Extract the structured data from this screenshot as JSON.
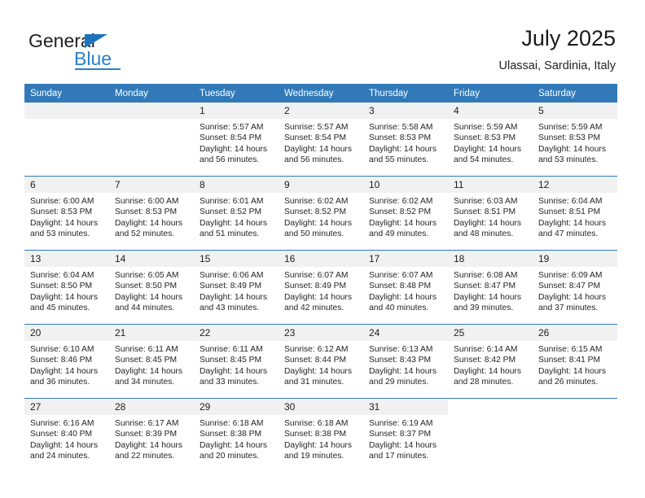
{
  "brand": {
    "name_part1": "General",
    "name_part2": "Blue"
  },
  "header": {
    "title": "July 2025",
    "subtitle": "Ulassai, Sardinia, Italy"
  },
  "calendar": {
    "weekday_headers": [
      "Sunday",
      "Monday",
      "Tuesday",
      "Wednesday",
      "Thursday",
      "Friday",
      "Saturday"
    ],
    "accent_color": "#3179b8",
    "daynum_band_color": "#f1f1f1",
    "weeks": [
      [
        {
          "day": "",
          "sunrise": "",
          "sunset": "",
          "daylight": "",
          "empty": true
        },
        {
          "day": "",
          "sunrise": "",
          "sunset": "",
          "daylight": "",
          "empty": true
        },
        {
          "day": "1",
          "sunrise": "Sunrise: 5:57 AM",
          "sunset": "Sunset: 8:54 PM",
          "daylight": "Daylight: 14 hours and 56 minutes."
        },
        {
          "day": "2",
          "sunrise": "Sunrise: 5:57 AM",
          "sunset": "Sunset: 8:54 PM",
          "daylight": "Daylight: 14 hours and 56 minutes."
        },
        {
          "day": "3",
          "sunrise": "Sunrise: 5:58 AM",
          "sunset": "Sunset: 8:53 PM",
          "daylight": "Daylight: 14 hours and 55 minutes."
        },
        {
          "day": "4",
          "sunrise": "Sunrise: 5:59 AM",
          "sunset": "Sunset: 8:53 PM",
          "daylight": "Daylight: 14 hours and 54 minutes."
        },
        {
          "day": "5",
          "sunrise": "Sunrise: 5:59 AM",
          "sunset": "Sunset: 8:53 PM",
          "daylight": "Daylight: 14 hours and 53 minutes."
        }
      ],
      [
        {
          "day": "6",
          "sunrise": "Sunrise: 6:00 AM",
          "sunset": "Sunset: 8:53 PM",
          "daylight": "Daylight: 14 hours and 53 minutes."
        },
        {
          "day": "7",
          "sunrise": "Sunrise: 6:00 AM",
          "sunset": "Sunset: 8:53 PM",
          "daylight": "Daylight: 14 hours and 52 minutes."
        },
        {
          "day": "8",
          "sunrise": "Sunrise: 6:01 AM",
          "sunset": "Sunset: 8:52 PM",
          "daylight": "Daylight: 14 hours and 51 minutes."
        },
        {
          "day": "9",
          "sunrise": "Sunrise: 6:02 AM",
          "sunset": "Sunset: 8:52 PM",
          "daylight": "Daylight: 14 hours and 50 minutes."
        },
        {
          "day": "10",
          "sunrise": "Sunrise: 6:02 AM",
          "sunset": "Sunset: 8:52 PM",
          "daylight": "Daylight: 14 hours and 49 minutes."
        },
        {
          "day": "11",
          "sunrise": "Sunrise: 6:03 AM",
          "sunset": "Sunset: 8:51 PM",
          "daylight": "Daylight: 14 hours and 48 minutes."
        },
        {
          "day": "12",
          "sunrise": "Sunrise: 6:04 AM",
          "sunset": "Sunset: 8:51 PM",
          "daylight": "Daylight: 14 hours and 47 minutes."
        }
      ],
      [
        {
          "day": "13",
          "sunrise": "Sunrise: 6:04 AM",
          "sunset": "Sunset: 8:50 PM",
          "daylight": "Daylight: 14 hours and 45 minutes."
        },
        {
          "day": "14",
          "sunrise": "Sunrise: 6:05 AM",
          "sunset": "Sunset: 8:50 PM",
          "daylight": "Daylight: 14 hours and 44 minutes."
        },
        {
          "day": "15",
          "sunrise": "Sunrise: 6:06 AM",
          "sunset": "Sunset: 8:49 PM",
          "daylight": "Daylight: 14 hours and 43 minutes."
        },
        {
          "day": "16",
          "sunrise": "Sunrise: 6:07 AM",
          "sunset": "Sunset: 8:49 PM",
          "daylight": "Daylight: 14 hours and 42 minutes."
        },
        {
          "day": "17",
          "sunrise": "Sunrise: 6:07 AM",
          "sunset": "Sunset: 8:48 PM",
          "daylight": "Daylight: 14 hours and 40 minutes."
        },
        {
          "day": "18",
          "sunrise": "Sunrise: 6:08 AM",
          "sunset": "Sunset: 8:47 PM",
          "daylight": "Daylight: 14 hours and 39 minutes."
        },
        {
          "day": "19",
          "sunrise": "Sunrise: 6:09 AM",
          "sunset": "Sunset: 8:47 PM",
          "daylight": "Daylight: 14 hours and 37 minutes."
        }
      ],
      [
        {
          "day": "20",
          "sunrise": "Sunrise: 6:10 AM",
          "sunset": "Sunset: 8:46 PM",
          "daylight": "Daylight: 14 hours and 36 minutes."
        },
        {
          "day": "21",
          "sunrise": "Sunrise: 6:11 AM",
          "sunset": "Sunset: 8:45 PM",
          "daylight": "Daylight: 14 hours and 34 minutes."
        },
        {
          "day": "22",
          "sunrise": "Sunrise: 6:11 AM",
          "sunset": "Sunset: 8:45 PM",
          "daylight": "Daylight: 14 hours and 33 minutes."
        },
        {
          "day": "23",
          "sunrise": "Sunrise: 6:12 AM",
          "sunset": "Sunset: 8:44 PM",
          "daylight": "Daylight: 14 hours and 31 minutes."
        },
        {
          "day": "24",
          "sunrise": "Sunrise: 6:13 AM",
          "sunset": "Sunset: 8:43 PM",
          "daylight": "Daylight: 14 hours and 29 minutes."
        },
        {
          "day": "25",
          "sunrise": "Sunrise: 6:14 AM",
          "sunset": "Sunset: 8:42 PM",
          "daylight": "Daylight: 14 hours and 28 minutes."
        },
        {
          "day": "26",
          "sunrise": "Sunrise: 6:15 AM",
          "sunset": "Sunset: 8:41 PM",
          "daylight": "Daylight: 14 hours and 26 minutes."
        }
      ],
      [
        {
          "day": "27",
          "sunrise": "Sunrise: 6:16 AM",
          "sunset": "Sunset: 8:40 PM",
          "daylight": "Daylight: 14 hours and 24 minutes."
        },
        {
          "day": "28",
          "sunrise": "Sunrise: 6:17 AM",
          "sunset": "Sunset: 8:39 PM",
          "daylight": "Daylight: 14 hours and 22 minutes."
        },
        {
          "day": "29",
          "sunrise": "Sunrise: 6:18 AM",
          "sunset": "Sunset: 8:38 PM",
          "daylight": "Daylight: 14 hours and 20 minutes."
        },
        {
          "day": "30",
          "sunrise": "Sunrise: 6:18 AM",
          "sunset": "Sunset: 8:38 PM",
          "daylight": "Daylight: 14 hours and 19 minutes."
        },
        {
          "day": "31",
          "sunrise": "Sunrise: 6:19 AM",
          "sunset": "Sunset: 8:37 PM",
          "daylight": "Daylight: 14 hours and 17 minutes."
        },
        {
          "day": "",
          "sunrise": "",
          "sunset": "",
          "daylight": "",
          "blank": true
        },
        {
          "day": "",
          "sunrise": "",
          "sunset": "",
          "daylight": "",
          "blank": true
        }
      ]
    ]
  }
}
